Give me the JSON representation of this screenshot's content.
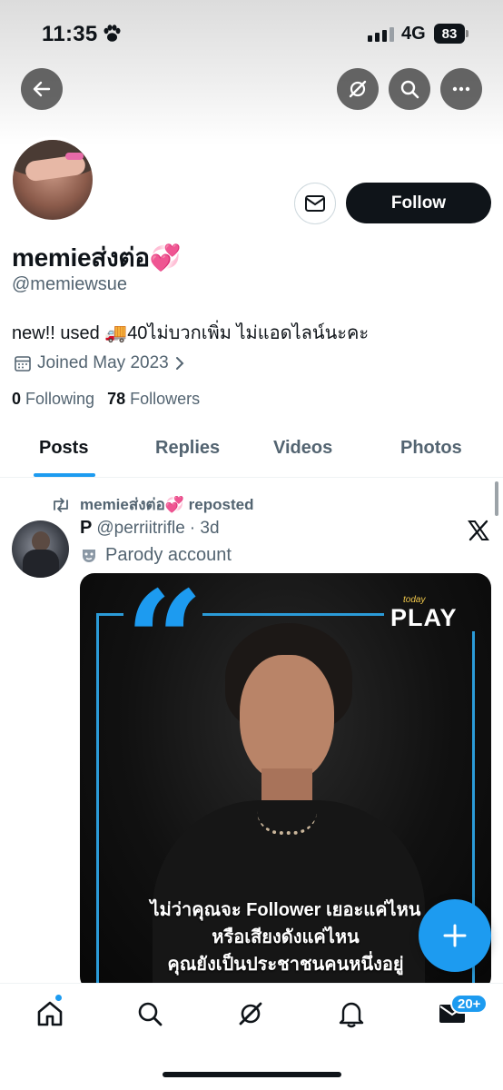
{
  "status_bar": {
    "time": "11:35",
    "network": "4G",
    "battery": "83"
  },
  "profile": {
    "name": "memieส่งต่อ💞",
    "handle": "@memiewsue",
    "bio": "new!! used 🚚40ไม่บวกเพิ่ม ไม่แอดไลน์นะคะ",
    "joined": "Joined May 2023",
    "following_count": "0",
    "following_label": "Following",
    "followers_count": "78",
    "followers_label": "Followers",
    "follow_button": "Follow"
  },
  "tabs": [
    {
      "label": "Posts",
      "active": true
    },
    {
      "label": "Replies",
      "active": false
    },
    {
      "label": "Videos",
      "active": false
    },
    {
      "label": "Photos",
      "active": false
    }
  ],
  "post": {
    "repost_label": "memieส่งต่อ💞 reposted",
    "author_name": "P",
    "author_handle": "@perriitrifle",
    "time": "· 3d",
    "parody_label": "Parody account",
    "media": {
      "brand_small": "today",
      "brand": "PLAY",
      "caption_lines": [
        "ไม่ว่าคุณจะ Follower เยอะแค่ไหน",
        "หรือเสียงดังแค่ไหน",
        "คุณยังเป็นประชาชนคนหนึ่งอยู่"
      ]
    }
  },
  "bottom_nav": {
    "messages_badge": "20+"
  },
  "colors": {
    "accent": "#1d9bf0",
    "text": "#0f1419",
    "secondary": "#536471"
  }
}
